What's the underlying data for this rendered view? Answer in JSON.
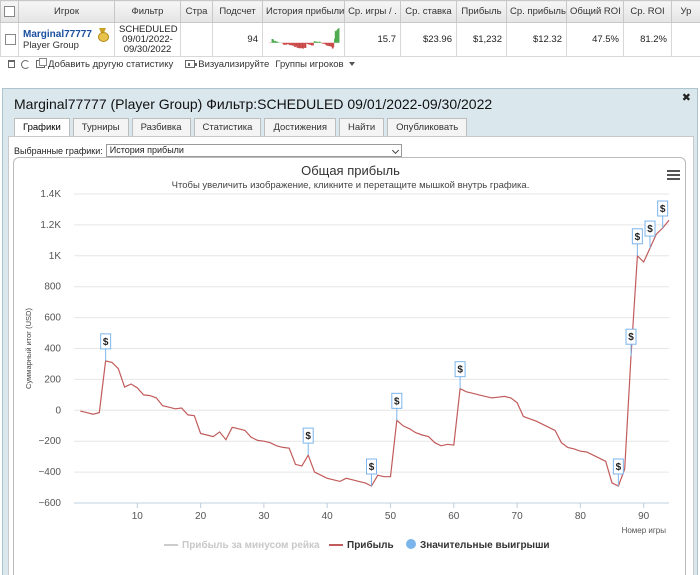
{
  "table": {
    "headers": [
      "Игрок",
      "Фильтр",
      "Стра",
      "Подсчет",
      "История прибыли",
      "Ср. игры / .",
      "Ср. ставка",
      "Прибыль",
      "Ср. прибыль",
      "Общий ROI",
      "Ср. ROI",
      "Ур"
    ],
    "row": {
      "player": "Marginal77777",
      "group": "Player Group",
      "filter_line1": "SCHEDULED",
      "filter_line2": "09/01/2022-",
      "filter_line3": "09/30/2022",
      "count": "94",
      "avg_games": "15.7",
      "avg_stake": "$23.96",
      "profit": "$1,232",
      "avg_profit": "$12.32",
      "total_roi": "47.5%",
      "avg_roi": "81.2%"
    }
  },
  "toolbar": {
    "add_stat": "Добавить другую статистику",
    "visualize": "Визуализируйте",
    "groups": "Группы игроков"
  },
  "panel": {
    "title": "Marginal77777 (Player Group) Фильтр:SCHEDULED 09/01/2022-09/30/2022",
    "close": "✖",
    "tabs": [
      "Графики",
      "Турниры",
      "Разбивка",
      "Статистика",
      "Достижения",
      "Найти",
      "Опубликовать"
    ],
    "selected_label": "Выбранные графики:",
    "selected_value": "История прибыли"
  },
  "colors": {
    "profit_line": "#c25b5b",
    "rake_line": "#cccccc",
    "big_wins": "#7cb5ec",
    "accent": "#1a4fa0"
  },
  "chart_data": {
    "type": "line",
    "title": "Общая прибыль",
    "subtitle": "Чтобы увеличить изображение, кликните и перетащите мышкой внутрь графика.",
    "xlabel": "Номер игры",
    "ylabel": "Суммарный итог (USD)",
    "xlim": [
      0,
      94
    ],
    "ylim": [
      -600,
      1400
    ],
    "x_ticks": [
      10,
      20,
      30,
      40,
      50,
      60,
      70,
      80,
      90
    ],
    "y_ticks": [
      -600,
      -400,
      -200,
      0,
      200,
      400,
      600,
      800,
      1000,
      1200,
      1400
    ],
    "y_tick_labels": [
      "−600",
      "−400",
      "−200",
      "0",
      "200",
      "400",
      "600",
      "800",
      "1K",
      "1.2K",
      "1.4K"
    ],
    "legend": [
      "Прибыль за минусом рейка",
      "Прибыль",
      "Значительные выигрыши"
    ],
    "legend_position": "bottom",
    "series": [
      {
        "name": "Прибыль",
        "x": [
          1,
          2,
          3,
          4,
          5,
          6,
          7,
          8,
          9,
          10,
          11,
          12,
          13,
          14,
          15,
          16,
          17,
          18,
          19,
          20,
          21,
          22,
          23,
          24,
          25,
          26,
          27,
          28,
          29,
          30,
          31,
          32,
          33,
          34,
          35,
          36,
          37,
          38,
          39,
          40,
          41,
          42,
          43,
          44,
          45,
          46,
          47,
          48,
          49,
          50,
          51,
          52,
          53,
          54,
          55,
          56,
          57,
          58,
          59,
          60,
          61,
          62,
          63,
          64,
          65,
          66,
          67,
          68,
          69,
          70,
          71,
          72,
          73,
          74,
          75,
          76,
          77,
          78,
          79,
          80,
          81,
          82,
          83,
          84,
          85,
          86,
          87,
          88,
          89,
          90,
          91,
          92,
          93,
          94
        ],
        "y": [
          -5,
          -15,
          -25,
          -15,
          320,
          310,
          270,
          150,
          170,
          145,
          100,
          95,
          80,
          30,
          20,
          10,
          15,
          -30,
          -35,
          -150,
          -160,
          -170,
          -140,
          -190,
          -110,
          -120,
          -130,
          -175,
          -195,
          -200,
          -210,
          -230,
          -240,
          -245,
          -350,
          -360,
          -290,
          -400,
          -420,
          -440,
          -450,
          -460,
          -440,
          -450,
          -460,
          -470,
          -490,
          -420,
          -430,
          -430,
          -65,
          -100,
          -120,
          -145,
          -160,
          -170,
          -210,
          -230,
          -220,
          -225,
          140,
          120,
          110,
          100,
          90,
          80,
          85,
          90,
          80,
          50,
          -40,
          -55,
          -70,
          -90,
          -110,
          -130,
          -210,
          -240,
          -250,
          -265,
          -270,
          -290,
          -310,
          -330,
          -470,
          -490,
          -380,
          350,
          1000,
          960,
          1050,
          1140,
          1180,
          1230
        ]
      }
    ],
    "big_wins": {
      "name": "Значительные выигрыши",
      "x": [
        5,
        37,
        47,
        51,
        61,
        86,
        88,
        89,
        91,
        93
      ],
      "label": "$"
    }
  }
}
